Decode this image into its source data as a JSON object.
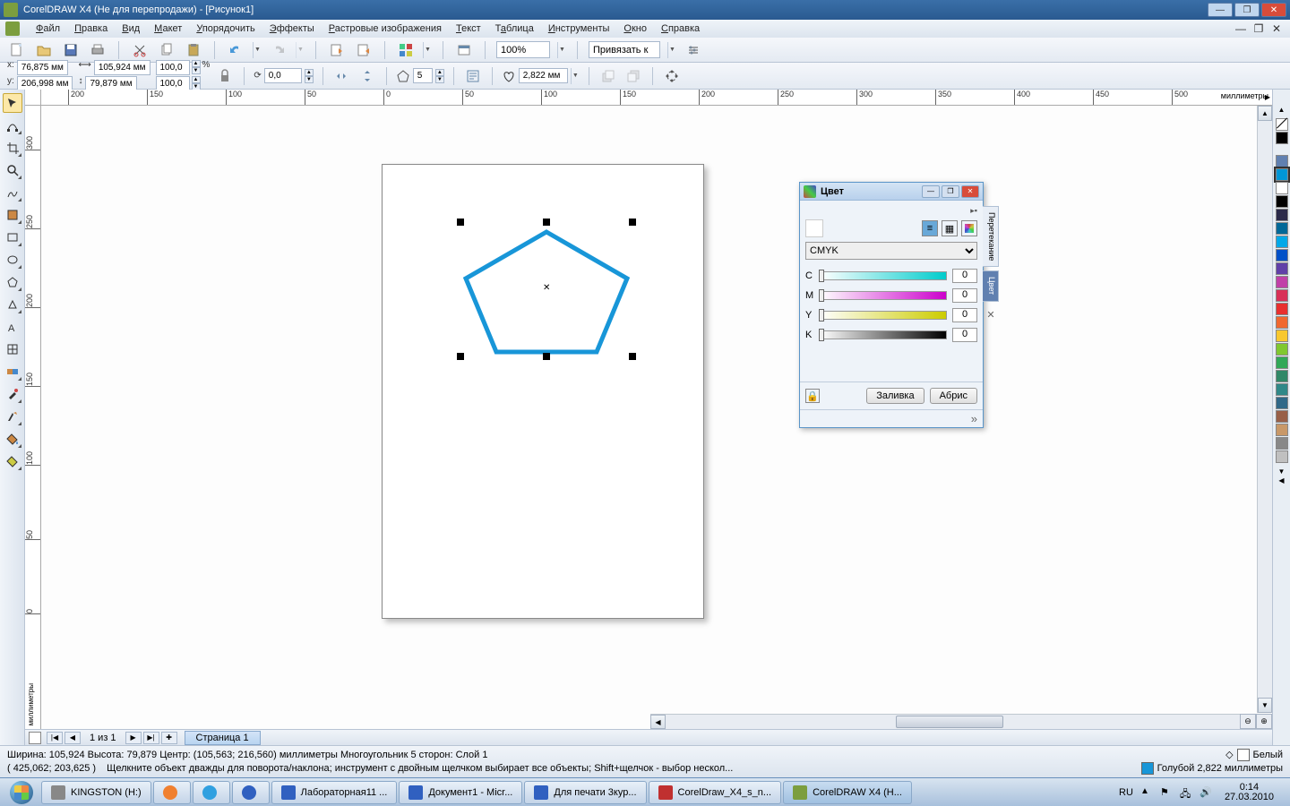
{
  "window": {
    "title": "CorelDRAW X4 (Не для перепродажи) - [Рисунок1]"
  },
  "menu": {
    "items": [
      "Файл",
      "Правка",
      "Вид",
      "Макет",
      "Упорядочить",
      "Эффекты",
      "Растровые изображения",
      "Текст",
      "Таблица",
      "Инструменты",
      "Окно",
      "Справка"
    ]
  },
  "toolbar1": {
    "zoom": "100%",
    "snap_label": "Привязать к"
  },
  "propbar": {
    "x_label": "x:",
    "x_val": "76,875 мм",
    "y_label": "y:",
    "y_val": "206,998 мм",
    "w_val": "105,924 мм",
    "h_val": "79,879 мм",
    "sx_val": "100,0",
    "sy_val": "100,0",
    "pct": "%",
    "rot_val": "0,0",
    "sides_val": "5",
    "outline_val": "2,822 мм"
  },
  "ruler": {
    "h": [
      "200",
      "150",
      "100",
      "50",
      "0",
      "50",
      "100",
      "150",
      "200",
      "250",
      "300",
      "350",
      "400",
      "450",
      "500"
    ],
    "h_units": "миллиметры",
    "v": [
      "300",
      "250",
      "200",
      "150",
      "100",
      "50",
      "0"
    ],
    "v_units": "миллиметры"
  },
  "docker": {
    "title": "Цвет",
    "model": "CMYK",
    "c_label": "C",
    "c_val": "0",
    "m_label": "M",
    "m_val": "0",
    "y_label": "Y",
    "y_val": "0",
    "k_label": "K",
    "k_val": "0",
    "fill_btn": "Заливка",
    "outline_btn": "Абрис",
    "tab1": "Перетекание",
    "tab2": "Цвет"
  },
  "palette": [
    "#ffffff",
    "#000000",
    "#1a1a1a",
    "#333333",
    "#4d4d4d",
    "#666666",
    "#808080",
    "#0096d6",
    "#003a9e",
    "#5a3a9e",
    "#a03a9e",
    "#d6003a",
    "#e84c00",
    "#ff9600",
    "#ffd600",
    "#96d600",
    "#00a04c",
    "#007a7a",
    "#005a96",
    "#3c6496",
    "#785a3c",
    "#966450"
  ],
  "pagenav": {
    "counter": "1 из 1",
    "page_tab": "Страница 1"
  },
  "status": {
    "line1": "Ширина: 105,924 Высота: 79,879 Центр: (105,563; 216,560) миллиметры      Многоугольник  5 сторон: Слой 1",
    "coords": "( 425,062; 203,625 )",
    "hint": "Щелкните объект дважды для поворота/наклона; инструмент с двойным щелчком выбирает все объекты; Shift+щелчок - выбор нескол...",
    "fill_label": "Белый",
    "outline_label": "Голубой  2,822 миллиметры"
  },
  "taskbar": {
    "items": [
      {
        "label": "KINGSTON (H:)",
        "color": "#888"
      },
      {
        "label": "",
        "color": "#f08030"
      },
      {
        "label": "",
        "color": "#30a0e0"
      },
      {
        "label": "",
        "color": "#3060c0"
      },
      {
        "label": "Лабораторная11 ...",
        "color": "#3060c0"
      },
      {
        "label": "Документ1 - Micr...",
        "color": "#3060c0"
      },
      {
        "label": "Для печати 3кур...",
        "color": "#3060c0"
      },
      {
        "label": "CorelDraw_X4_s_n...",
        "color": "#c03030"
      },
      {
        "label": "CorelDRAW X4 (Н...",
        "color": "#7c9e3f",
        "active": true
      }
    ],
    "lang": "RU",
    "time": "0:14",
    "date": "27.03.2010"
  }
}
